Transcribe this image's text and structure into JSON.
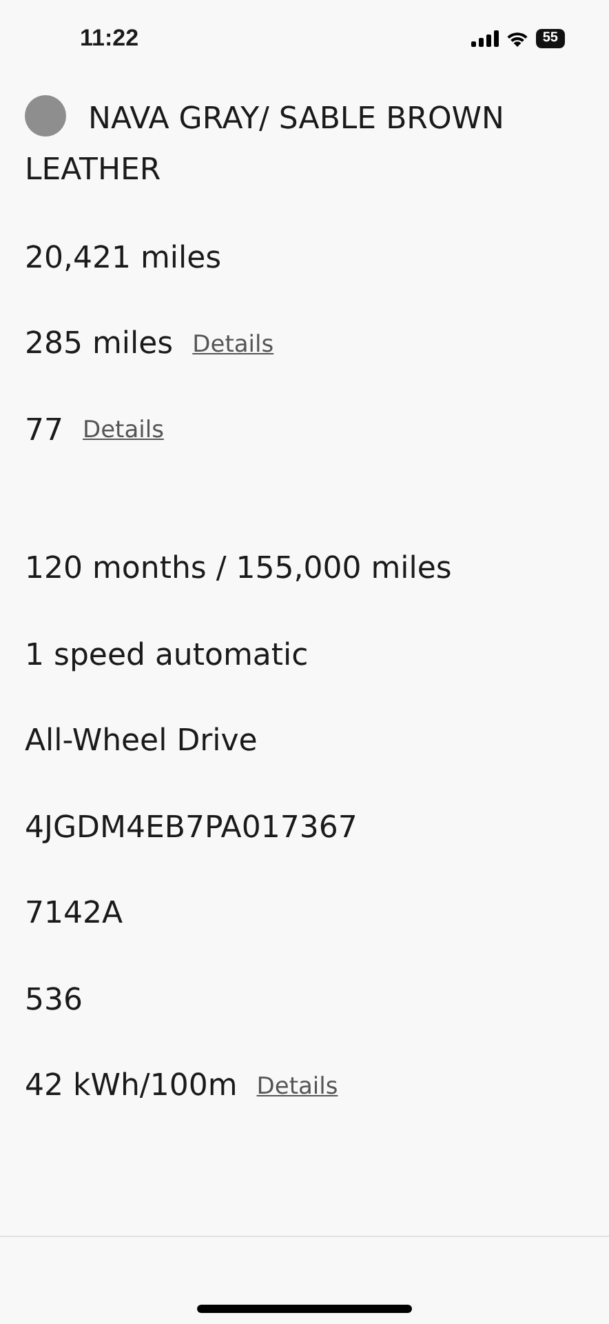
{
  "status_bar": {
    "time": "11:22",
    "battery": "55"
  },
  "color_row": {
    "color": "#8e8e8e",
    "text": "NAVA GRAY/ SABLE BROWN LEATHER"
  },
  "sections": [
    {
      "rows": [
        {
          "value": "20,421 miles"
        },
        {
          "value": "285 miles",
          "link": "Details"
        },
        {
          "value": "77",
          "link": "Details"
        }
      ]
    },
    {
      "rows": [
        {
          "value": "120 months / 155,000 miles"
        },
        {
          "value": "1 speed automatic"
        },
        {
          "value": "All-Wheel Drive"
        },
        {
          "value": "4JGDM4EB7PA017367"
        },
        {
          "value": "7142A"
        },
        {
          "value": "536"
        },
        {
          "value": "42 kWh/100m",
          "link": "Details"
        }
      ]
    }
  ]
}
